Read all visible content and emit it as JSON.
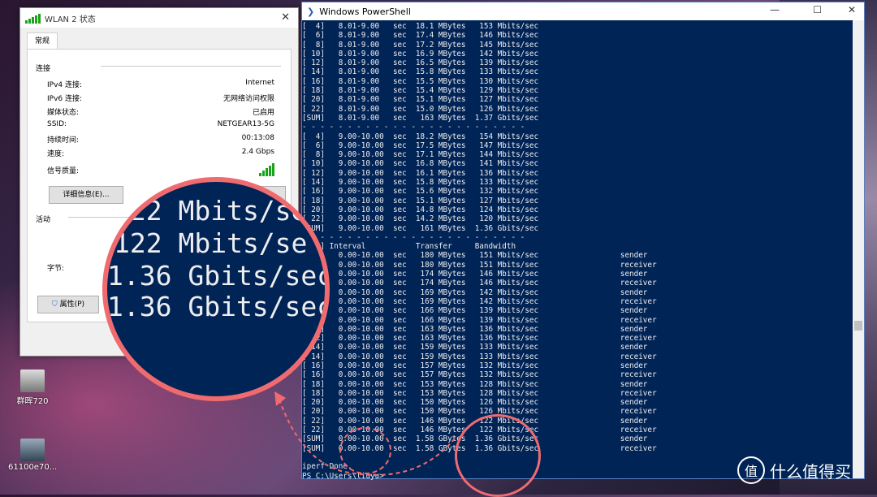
{
  "wlan": {
    "title": "WLAN 2 状态",
    "close_glyph": "✕",
    "tab": "常规",
    "section_connection": "连接",
    "rows": [
      {
        "label": "IPv4 连接:",
        "value": "Internet"
      },
      {
        "label": "IPv6 连接:",
        "value": "无网络访问权限"
      },
      {
        "label": "媒体状态:",
        "value": "已启用"
      },
      {
        "label": "SSID:",
        "value": "NETGEAR13-5G"
      },
      {
        "label": "持续时间:",
        "value": "00:13:08"
      },
      {
        "label": "速度:",
        "value": "2.4 Gbps"
      }
    ],
    "signal_label": "信号质量:",
    "details_button": "详细信息(E)...",
    "section_activity": "活动",
    "bytes_label": "字节:",
    "properties_button": "属性(P)"
  },
  "powershell": {
    "title": "Windows PowerShell",
    "minimize": "—",
    "maximize": "☐",
    "close": "✕",
    "lines": [
      "[  4]   8.01-9.00   sec  18.1 MBytes   153 Mbits/sec",
      "[  6]   8.01-9.00   sec  17.4 MBytes   146 Mbits/sec",
      "[  8]   8.01-9.00   sec  17.2 MBytes   145 Mbits/sec",
      "[ 10]   8.01-9.00   sec  16.9 MBytes   142 Mbits/sec",
      "[ 12]   8.01-9.00   sec  16.5 MBytes   139 Mbits/sec",
      "[ 14]   8.01-9.00   sec  15.8 MBytes   133 Mbits/sec",
      "[ 16]   8.01-9.00   sec  15.5 MBytes   130 Mbits/sec",
      "[ 18]   8.01-9.00   sec  15.4 MBytes   129 Mbits/sec",
      "[ 20]   8.01-9.00   sec  15.1 MBytes   127 Mbits/sec",
      "[ 22]   8.01-9.00   sec  15.0 MBytes   126 Mbits/sec",
      "[SUM]   8.01-9.00   sec   163 MBytes  1.37 Gbits/sec",
      "- - - - - - - - - - - - - - - - - - - - - - - - -",
      "[  4]   9.00-10.00  sec  18.2 MBytes   154 Mbits/sec",
      "[  6]   9.00-10.00  sec  17.5 MBytes   147 Mbits/sec",
      "[  8]   9.00-10.00  sec  17.1 MBytes   144 Mbits/sec",
      "[ 10]   9.00-10.00  sec  16.8 MBytes   141 Mbits/sec",
      "[ 12]   9.00-10.00  sec  16.1 MBytes   136 Mbits/sec",
      "[ 14]   9.00-10.00  sec  15.8 MBytes   133 Mbits/sec",
      "[ 16]   9.00-10.00  sec  15.6 MBytes   132 Mbits/sec",
      "[ 18]   9.00-10.00  sec  15.1 MBytes   127 Mbits/sec",
      "[ 20]   9.00-10.00  sec  14.8 MBytes   124 Mbits/sec",
      "[ 22]   9.00-10.00  sec  14.2 MBytes   120 Mbits/sec",
      "[SUM]   9.00-10.00  sec   161 MBytes  1.36 Gbits/sec",
      "- - - - - - - - - - - - - - - - - - - - - - - - -",
      "[ ID] Interval           Transfer     Bandwidth",
      "[  4]   0.00-10.00  sec   180 MBytes   151 Mbits/sec                  sender",
      "[  4]   0.00-10.00  sec   180 MBytes   151 Mbits/sec                  receiver",
      "[  6]   0.00-10.00  sec   174 MBytes   146 Mbits/sec                  sender",
      "[  6]   0.00-10.00  sec   174 MBytes   146 Mbits/sec                  receiver",
      "[  8]   0.00-10.00  sec   169 MBytes   142 Mbits/sec                  sender",
      "[  8]   0.00-10.00  sec   169 MBytes   142 Mbits/sec                  receiver",
      "[ 10]   0.00-10.00  sec   166 MBytes   139 Mbits/sec                  sender",
      "[ 10]   0.00-10.00  sec   166 MBytes   139 Mbits/sec                  receiver",
      "[ 12]   0.00-10.00  sec   163 MBytes   136 Mbits/sec                  sender",
      "[ 12]   0.00-10.00  sec   163 MBytes   136 Mbits/sec                  receiver",
      "[ 14]   0.00-10.00  sec   159 MBytes   133 Mbits/sec                  sender",
      "[ 14]   0.00-10.00  sec   159 MBytes   133 Mbits/sec                  receiver",
      "[ 16]   0.00-10.00  sec   157 MBytes   132 Mbits/sec                  sender",
      "[ 16]   0.00-10.00  sec   157 MBytes   132 Mbits/sec                  receiver",
      "[ 18]   0.00-10.00  sec   153 MBytes   128 Mbits/sec                  sender",
      "[ 18]   0.00-10.00  sec   153 MBytes   128 Mbits/sec                  receiver",
      "[ 20]   0.00-10.00  sec   150 MBytes   126 Mbits/sec                  sender",
      "[ 20]   0.00-10.00  sec   150 MBytes   126 Mbits/sec                  receiver",
      "[ 22]   0.00-10.00  sec   146 MBytes   122 Mbits/sec                  sender",
      "[ 22]   0.00-10.00  sec   146 MBytes   122 Mbits/sec                  receiver",
      "[SUM]   0.00-10.00  sec  1.58 GBytes  1.36 Gbits/sec                  sender",
      "[SUM]   0.00-10.00  sec  1.58 GBytes  1.36 Gbits/sec                  receiver",
      "",
      "iperf Done.",
      "PS C:\\Users\\liuyu>"
    ]
  },
  "zoom_lines": [
    "122 Mbits/se",
    "122 Mbits/se",
    "1.36 Gbits/sec",
    "1.36 Gbits/sec"
  ],
  "desktop_icons": [
    {
      "label": "群晖720"
    },
    {
      "label": "61100e70..."
    }
  ],
  "watermark": {
    "logo": "值",
    "text": "什么值得买"
  },
  "colors": {
    "ps_bg": "#012456",
    "highlight": "#f06b6f",
    "signal": "#1aa31a"
  }
}
